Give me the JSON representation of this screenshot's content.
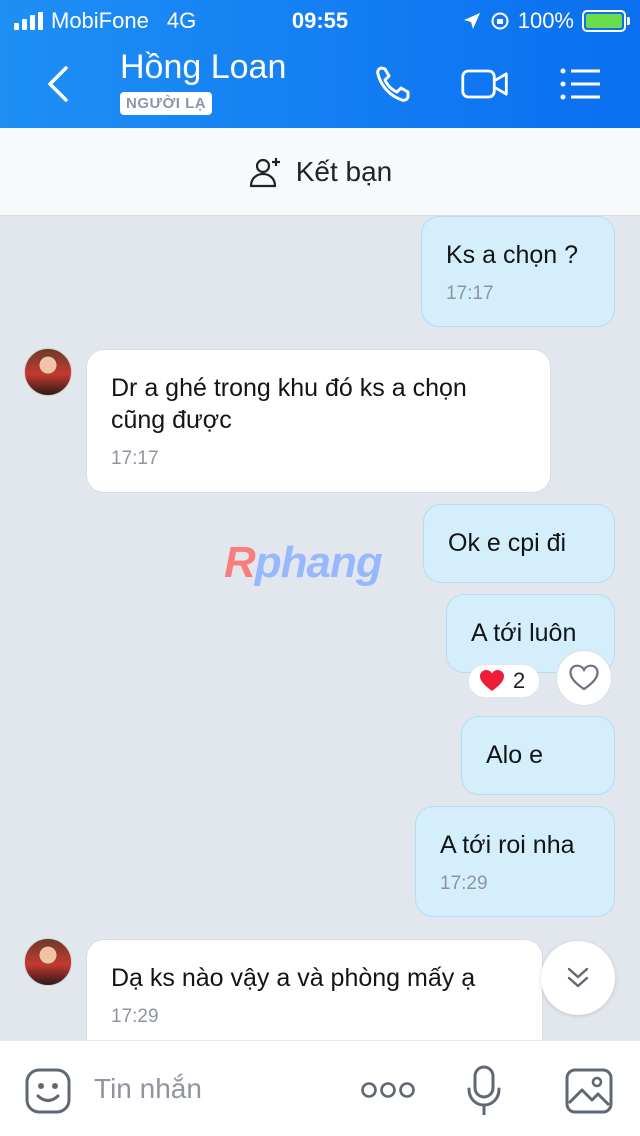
{
  "status": {
    "carrier": "MobiFone",
    "network": "4G",
    "time": "09:55",
    "battery": "100%"
  },
  "header": {
    "title": "Hồng Loan",
    "badge": "NGƯỜI LẠ"
  },
  "friend_bar": {
    "label": "Kết bạn"
  },
  "messages": [
    {
      "dir": "out",
      "text": "Ks a chọn ?",
      "time": "17:17"
    },
    {
      "dir": "in",
      "line1": "Dr a ghé trong khu đó ks a chọn",
      "line2": "cũng được",
      "time": "17:17"
    },
    {
      "dir": "out",
      "text": "Ok e cpi đi"
    },
    {
      "dir": "out",
      "text": "A tới luôn",
      "reaction_count": "2"
    },
    {
      "dir": "out",
      "text": "Alo e"
    },
    {
      "dir": "out",
      "text": "A tới roi nha",
      "time": "17:29"
    },
    {
      "dir": "in",
      "text": "Dạ ks nào vậy a và phòng mấy ạ",
      "time": "17:29"
    }
  ],
  "watermark": {
    "first": "R",
    "rest": "phang"
  },
  "composer": {
    "placeholder": "Tin nhắn"
  },
  "colors": {
    "header": "#0a7cf2",
    "outgoing": "#d4eefc",
    "incoming": "#ffffff",
    "background": "#e2e7ee"
  },
  "icons": [
    "back-icon",
    "phone-icon",
    "video-icon",
    "menu-icon",
    "add-friend-icon",
    "heart-icon",
    "scroll-down-icon",
    "sticker-icon",
    "more-icon",
    "mic-icon",
    "image-icon"
  ]
}
